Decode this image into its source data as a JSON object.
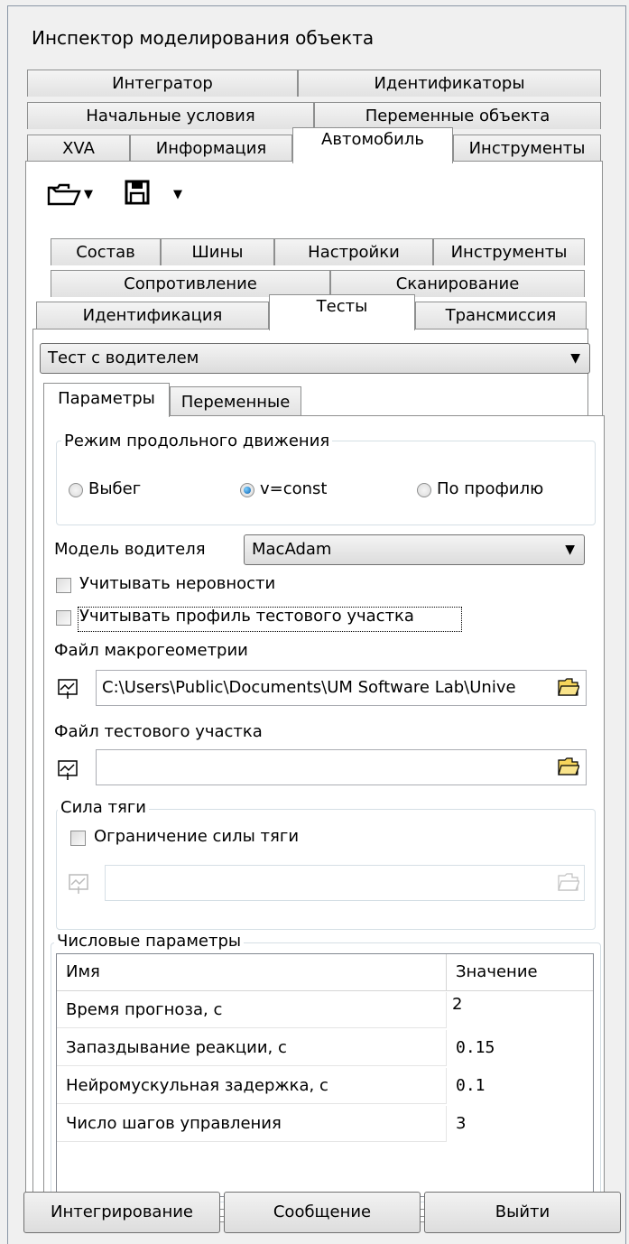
{
  "window_title": "Инспектор моделирования объекта",
  "top_tabs": {
    "row1": [
      "Интегратор",
      "Идентификаторы"
    ],
    "row2": [
      "Начальные условия",
      "Переменные объекта"
    ],
    "row3": [
      "XVA",
      "Информация",
      "Автомобиль",
      "Инструменты"
    ],
    "active": "Автомобиль"
  },
  "toolbar": {
    "open_icon": "folder-open-icon",
    "save_icon": "floppy-disk-icon",
    "dropdown_glyph": "▼"
  },
  "inner_tabs": {
    "row1": [
      "Состав",
      "Шины",
      "Настройки",
      "Инструменты"
    ],
    "row2": [
      "Сопротивление",
      "Сканирование"
    ],
    "row3": [
      "Идентификация",
      "Тесты",
      "Трансмиссия"
    ],
    "active": "Тесты"
  },
  "test_select": {
    "value": "Тест с водителем"
  },
  "sub_tabs": {
    "items": [
      "Параметры",
      "Переменные"
    ],
    "active": "Параметры"
  },
  "motion_mode": {
    "label": "Режим продольного движения",
    "options": [
      "Выбег",
      "v=const",
      "По профилю"
    ],
    "selected": "v=const"
  },
  "driver_model": {
    "label": "Модель водителя",
    "value": "MacAdam"
  },
  "checkboxes": {
    "roughness": "Учитывать неровности",
    "profile": "Учитывать профиль тестового участка"
  },
  "macro_file": {
    "label": "Файл макрогеометрии",
    "value": "C:\\Users\\Public\\Documents\\UM Software Lab\\Unive"
  },
  "test_file": {
    "label": "Файл тестового участка",
    "value": ""
  },
  "traction": {
    "label": "Сила тяги",
    "limit_label": "Ограничение силы тяги",
    "value": ""
  },
  "numeric": {
    "label": "Числовые параметры",
    "headers": [
      "Имя",
      "Значение"
    ],
    "rows": [
      [
        "Время прогноза, с",
        "2"
      ],
      [
        "Запаздывание реакции, с",
        "0.15"
      ],
      [
        "Нейромускульная задержка, с",
        "0.1"
      ],
      [
        "Число шагов управления",
        "3"
      ]
    ]
  },
  "buttons": {
    "integrate": "Интегрирование",
    "message": "Сообщение",
    "exit": "Выйти"
  }
}
